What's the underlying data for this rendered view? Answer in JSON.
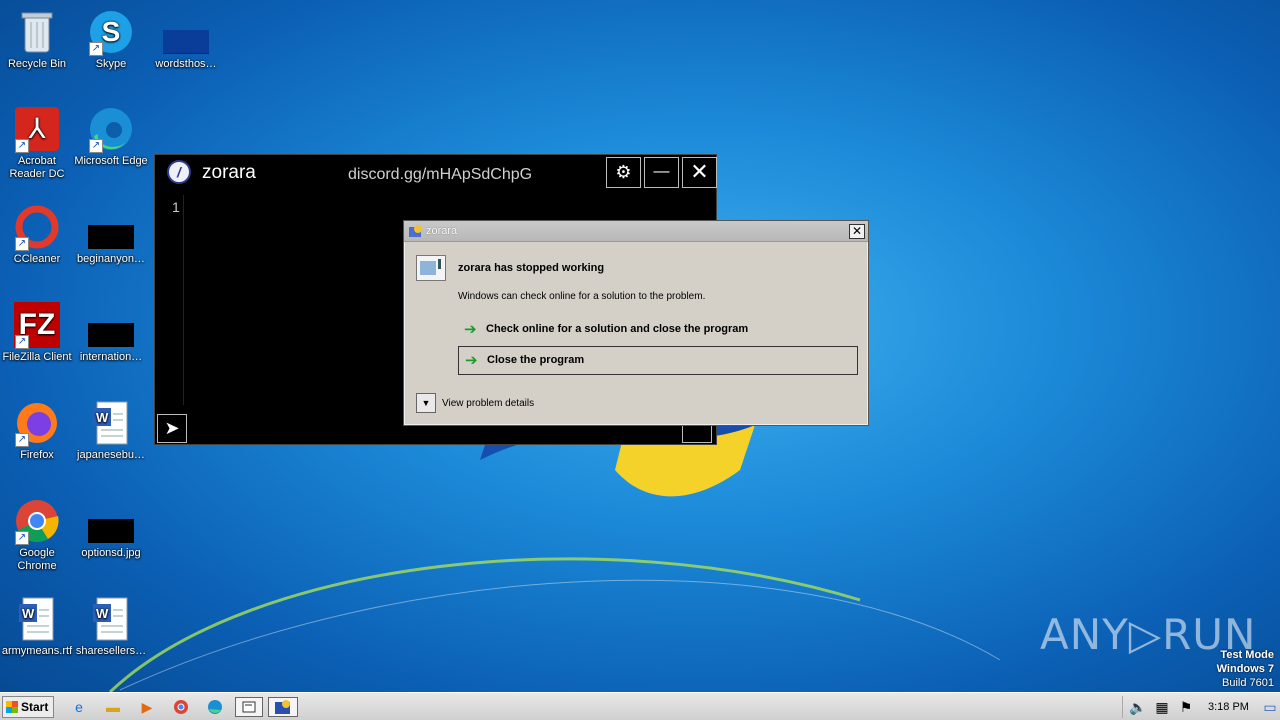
{
  "desktop": {
    "icons": [
      {
        "label": "Recycle Bin",
        "icon": "recycle-bin-icon"
      },
      {
        "label": "Skype",
        "icon": "skype-icon"
      },
      {
        "label": "wordsthos…",
        "icon": "blank-file-icon"
      },
      {
        "label": "Acrobat Reader DC",
        "icon": "acrobat-icon"
      },
      {
        "label": "Microsoft Edge",
        "icon": "edge-icon"
      },
      {
        "label": "CCleaner",
        "icon": "ccleaner-icon"
      },
      {
        "label": "beginanyon…",
        "icon": "blank-file-icon"
      },
      {
        "label": "FileZilla Client",
        "icon": "filezilla-icon"
      },
      {
        "label": "internation…",
        "icon": "blank-file-icon"
      },
      {
        "label": "Firefox",
        "icon": "firefox-icon"
      },
      {
        "label": "japanesebu…",
        "icon": "word-doc-icon"
      },
      {
        "label": "Google Chrome",
        "icon": "chrome-icon"
      },
      {
        "label": "optionsd.jpg",
        "icon": "blank-file-icon"
      },
      {
        "label": "armymeans.rtf",
        "icon": "word-doc-icon"
      },
      {
        "label": "sharesellers…",
        "icon": "word-doc-icon"
      }
    ]
  },
  "zorara_window": {
    "title": "zorara",
    "discord": "discord.gg/mHApSdChpG",
    "settings_glyph": "⚙",
    "minimize_glyph": "—",
    "close_glyph": "✕",
    "line_number": "1",
    "run_glyph": "➤"
  },
  "dialog": {
    "title": "zorara",
    "close_glyph": "✕",
    "heading": "zorara has stopped working",
    "description": "Windows can check online for a solution to the problem.",
    "option_check": "Check online for a solution and close the program",
    "option_close": "Close the program",
    "details": "View problem details",
    "arrow_glyph": "➔"
  },
  "watermark": {
    "brand": "ANY▷RUN",
    "test_mode": "Test Mode",
    "os": "Windows 7",
    "build": "Build 7601"
  },
  "taskbar": {
    "start_label": "Start",
    "clock": "3:18 PM",
    "pinned": [
      "ie-icon",
      "explorer-icon",
      "media-player-icon",
      "chrome-icon",
      "edge-icon",
      "zorara-task-icon",
      "error-report-task-icon"
    ]
  }
}
